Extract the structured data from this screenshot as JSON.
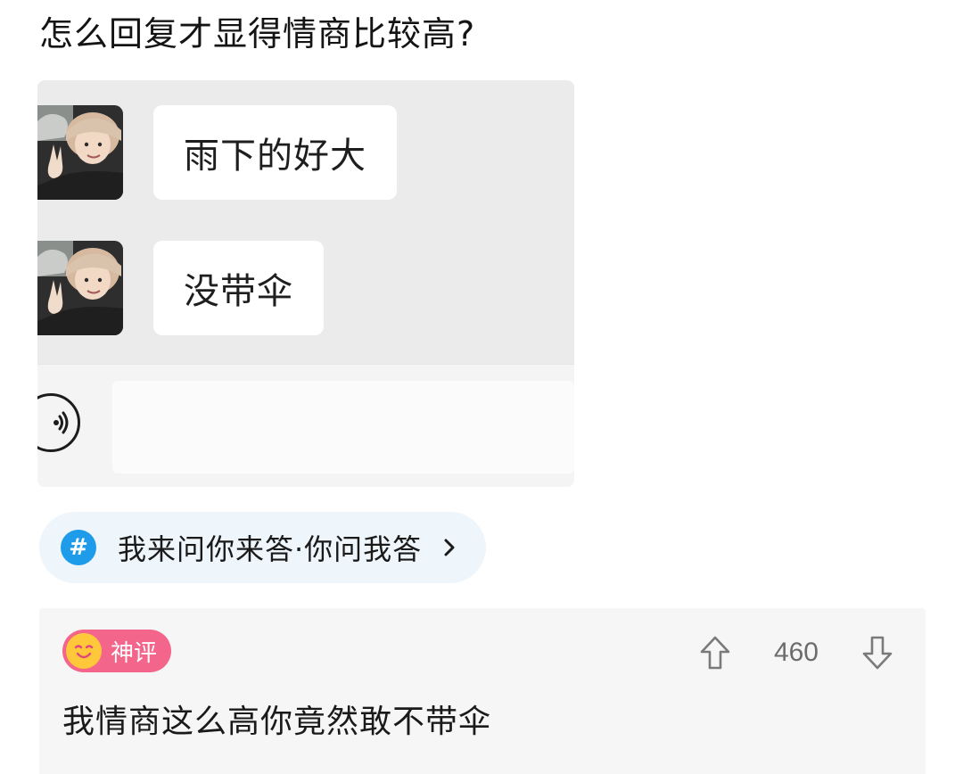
{
  "question": {
    "title": "怎么回复才显得情商比较高?"
  },
  "chat": {
    "messages": [
      {
        "text": "雨下的好大"
      },
      {
        "text": "没带伞"
      }
    ]
  },
  "topic": {
    "icon": "hashtag-icon",
    "label": "我来问你来答·你问我答"
  },
  "comment": {
    "badge_label": "神评",
    "vote_count": "460",
    "text": "我情商这么高你竟然敢不带伞"
  },
  "colors": {
    "topic_icon_bg": "#1e9be9",
    "badge_bg": "#f3658a",
    "badge_face": "#ffc83b"
  }
}
